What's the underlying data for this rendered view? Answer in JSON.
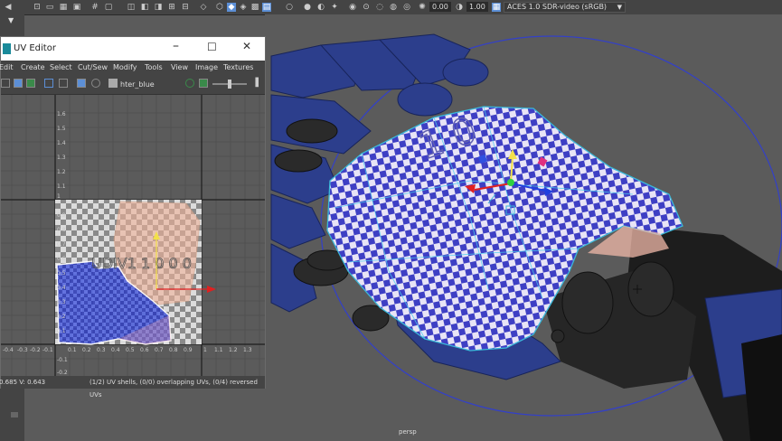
{
  "top_toolbar": {
    "value_a": "0.00",
    "value_b": "1.00",
    "color_space": "ACES 1.0 SDR-video (sRGB)"
  },
  "uv_editor": {
    "title": "UV Editor",
    "menu": [
      "Edit",
      "Create",
      "Select",
      "Cut/Sew",
      "Modify",
      "Tools",
      "View",
      "Image",
      "Textures"
    ],
    "texture_name": "hter_blue",
    "v_ticks": [
      "1.6",
      "1.5",
      "1.4",
      "1.3",
      "1.2",
      "1.1",
      "1",
      "0.9",
      "0.8",
      "0.7",
      "0.6",
      "0.5",
      "0.4",
      "0.3",
      "0.2",
      "0.1",
      "-0.1",
      "-0.2"
    ],
    "u_ticks": [
      "-0.4",
      "-0.3",
      "-0.2",
      "-0.1",
      "0.1",
      "0.2",
      "0.3",
      "0.4",
      "0.5",
      "0.6",
      "0.7",
      "0.8",
      "0.9",
      "1",
      "1.1",
      "1.2",
      "1.3"
    ],
    "status_uv": "0.685  V:  0.643",
    "status_shells": "(1/2) UV shells, (0/0) overlapping UVs, (0/4) reversed UVs"
  },
  "viewport": {
    "camera_label": "persp",
    "decal_text": "1 0",
    "uv_decal": "UDIV1 1 0 0 0"
  },
  "colors": {
    "ui_dark": "#444444",
    "viewport_bg": "#5b5b5b",
    "mesh_blue": "#2a3d8a",
    "checker_blue": "#3f40c8",
    "selection_cyan": "#3ab8d8",
    "manip_y": "#f2e04a",
    "manip_x": "#e02020"
  }
}
